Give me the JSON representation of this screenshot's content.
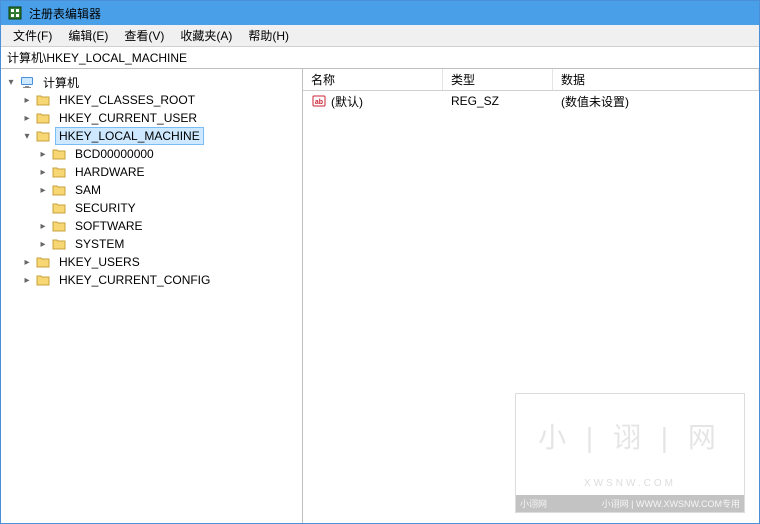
{
  "window": {
    "title": "注册表编辑器"
  },
  "menu": {
    "file": "文件(F)",
    "edit": "编辑(E)",
    "view": "查看(V)",
    "favorites": "收藏夹(A)",
    "help": "帮助(H)"
  },
  "address": {
    "path": "计算机\\HKEY_LOCAL_MACHINE"
  },
  "tree": {
    "root": "计算机",
    "hives": {
      "classes_root": "HKEY_CLASSES_ROOT",
      "current_user": "HKEY_CURRENT_USER",
      "local_machine": "HKEY_LOCAL_MACHINE",
      "users": "HKEY_USERS",
      "current_config": "HKEY_CURRENT_CONFIG"
    },
    "local_machine_children": {
      "bcd": "BCD00000000",
      "hardware": "HARDWARE",
      "sam": "SAM",
      "security": "SECURITY",
      "software": "SOFTWARE",
      "system": "SYSTEM"
    }
  },
  "list": {
    "headers": {
      "name": "名称",
      "type": "类型",
      "data": "数据"
    },
    "rows": [
      {
        "name": "(默认)",
        "type": "REG_SZ",
        "data": "(数值未设置)"
      }
    ]
  },
  "watermark": {
    "main": "小 | 诩 | 网",
    "sub": "XWSNW.COM",
    "bar_left": "小诩网",
    "bar_right": "小诩网 | WWW.XWSNW.COM专用"
  }
}
